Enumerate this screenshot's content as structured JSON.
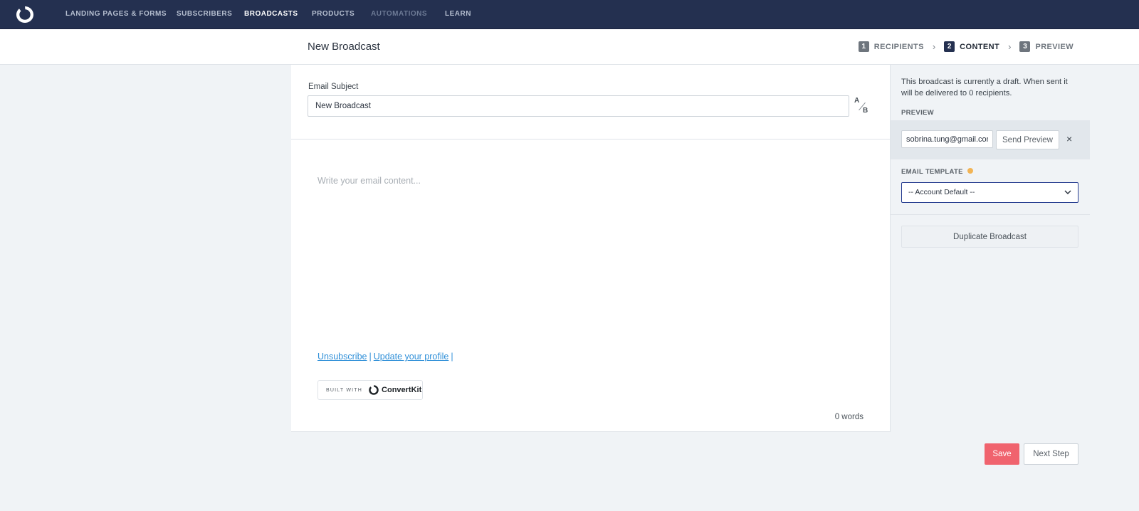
{
  "nav": {
    "items": [
      {
        "label": "LANDING PAGES & FORMS",
        "state": "normal"
      },
      {
        "label": "SUBSCRIBERS",
        "state": "normal"
      },
      {
        "label": "BROADCASTS",
        "state": "active"
      },
      {
        "label": "PRODUCTS",
        "state": "normal"
      },
      {
        "label": "AUTOMATIONS",
        "state": "disabled"
      },
      {
        "label": "LEARN",
        "state": "normal"
      }
    ]
  },
  "header": {
    "title": "New Broadcast",
    "steps": [
      {
        "number": "1",
        "label": "RECIPIENTS",
        "active": false
      },
      {
        "number": "2",
        "label": "CONTENT",
        "active": true
      },
      {
        "number": "3",
        "label": "PREVIEW",
        "active": false
      }
    ]
  },
  "editor": {
    "subject_label": "Email Subject",
    "subject_value": "New Broadcast",
    "ab": {
      "a": "A",
      "b": "B"
    },
    "body_placeholder": "Write your email content...",
    "footer": {
      "unsubscribe": "Unsubscribe",
      "separator": "|",
      "update_profile": "Update your profile",
      "trailing": "|"
    },
    "badge": {
      "built_with": "BUILT WITH",
      "brand": "ConvertKit"
    },
    "word_count": "0 words"
  },
  "sidebar": {
    "draft_text": "This broadcast is currently a draft. When sent it will be delivered to 0 recipients.",
    "preview_label": "PREVIEW",
    "preview_email": "sobrina.tung@gmail.com",
    "send_preview_label": "Send Preview",
    "close_glyph": "×",
    "template_label": "EMAIL TEMPLATE",
    "template_value": "-- Account Default --",
    "duplicate_label": "Duplicate Broadcast"
  },
  "actions": {
    "save_label": "Save",
    "next_label": "Next Step"
  },
  "colors": {
    "nav_bg": "#243050",
    "save": "#f0636e",
    "link": "#2f8fd8",
    "select_border": "#243b8f",
    "template_dot": "#f2b455"
  }
}
